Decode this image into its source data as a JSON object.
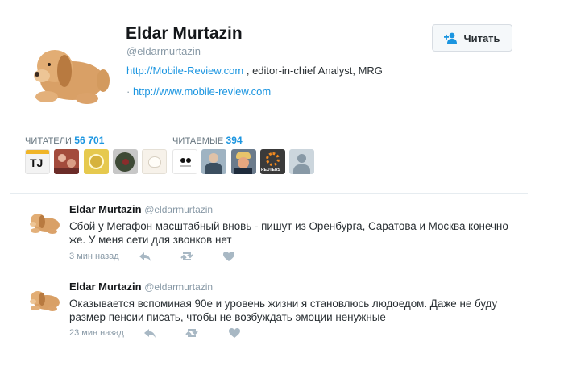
{
  "profile": {
    "name": "Eldar Murtazin",
    "handle": "@eldarmurtazin",
    "bio_link": "http://Mobile-Review.com",
    "bio_rest": " , editor-in-chief Analyst, MRG",
    "site_prefix": "· ",
    "site_link": "http://www.mobile-review.com"
  },
  "follow_button": {
    "label": "Читать",
    "icon": "add-user-icon"
  },
  "followers": {
    "label": "ЧИТАТЕЛИ",
    "count": "56 701"
  },
  "following": {
    "label": "ЧИТАЕМЫЕ",
    "count": "394"
  },
  "follower_thumbs": [
    "TJ",
    "",
    "",
    "",
    ""
  ],
  "following_thumbs": [
    "",
    "",
    "",
    "REUTERS",
    ""
  ],
  "tweets": [
    {
      "name": "Eldar Murtazin",
      "handle": "@eldarmurtazin",
      "text_line1": "Сбой у Мегафон масштабный вновь - пишут из Оренбурга, Саратова и Москва конечно",
      "text_line2": "же. У меня сети для звонков нет",
      "time": "3 мин назад"
    },
    {
      "name": "Eldar Murtazin",
      "handle": "@eldarmurtazin",
      "text_line1": "Оказывается вспоминая 90е и уровень жизни я становлюсь людоедом. Даже не буду",
      "text_line2": "размер пенсии писать, чтобы не возбуждать эмоции ненужные",
      "time": "23 мин назад"
    }
  ],
  "colors": {
    "link": "#1b95e0",
    "muted": "#8899a6",
    "text": "#292f33"
  }
}
